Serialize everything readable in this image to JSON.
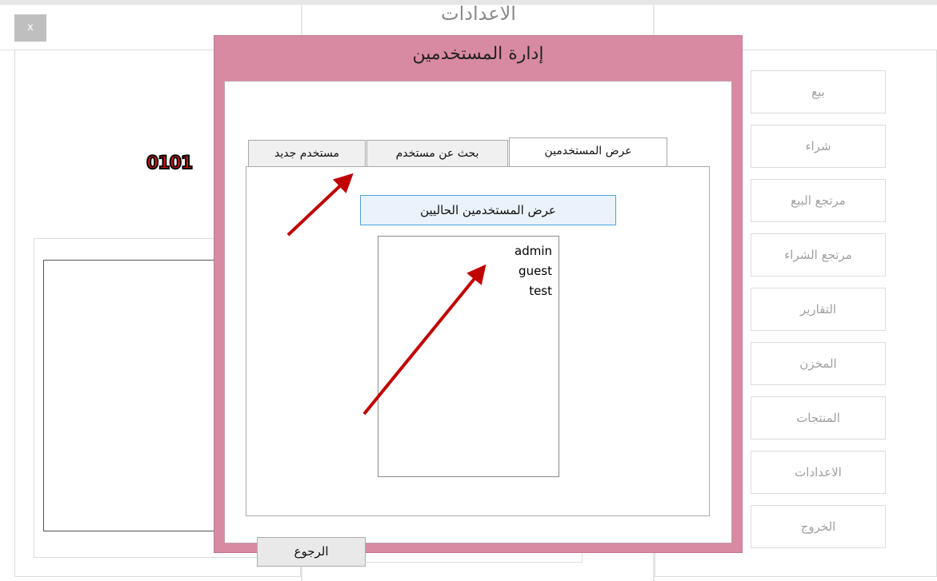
{
  "background": {
    "close_label": "x",
    "window_title": "الاعدادات",
    "logo_text": "0101",
    "menu": [
      {
        "label": "بيع"
      },
      {
        "label": "شراء"
      },
      {
        "label": "مرتجع البيع"
      },
      {
        "label": "مرتجع الشراء"
      },
      {
        "label": "التقارير"
      },
      {
        "label": "المخزن"
      },
      {
        "label": "المنتجات"
      },
      {
        "label": "الاعدادات"
      },
      {
        "label": "الخروج"
      }
    ]
  },
  "dialog": {
    "title": "إدارة المستخدمين",
    "tabs": [
      {
        "label": "عرض المستخدمين",
        "active": true
      },
      {
        "label": "بحث عن مستخدم",
        "active": false
      },
      {
        "label": "مستخدم جديد",
        "active": false
      }
    ],
    "show_button": "عرض المستخدمين الحاليين",
    "users": [
      "admin",
      "guest",
      "test"
    ],
    "back_button": "الرجوع"
  },
  "colors": {
    "dialog_frame": "#d98aa3",
    "arrow": "#c00000",
    "focus_border": "#4aa3df"
  }
}
